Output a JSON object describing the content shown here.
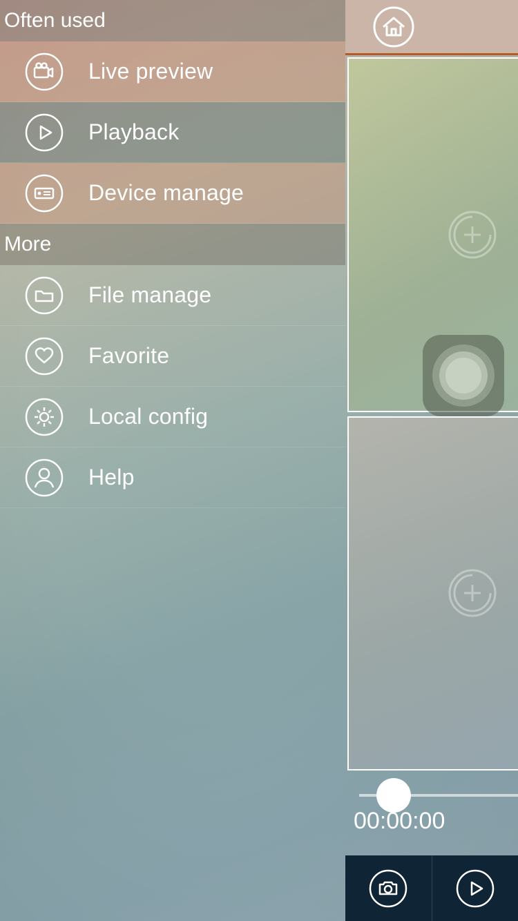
{
  "sections": {
    "often_used": "Often used",
    "more": "More"
  },
  "menu": {
    "live_preview": "Live preview",
    "playback": "Playback",
    "device_manage": "Device manage",
    "file_manage": "File manage",
    "favorite": "Favorite",
    "local_config": "Local config",
    "help": "Help"
  },
  "main": {
    "timestamp": "00:00:00"
  }
}
